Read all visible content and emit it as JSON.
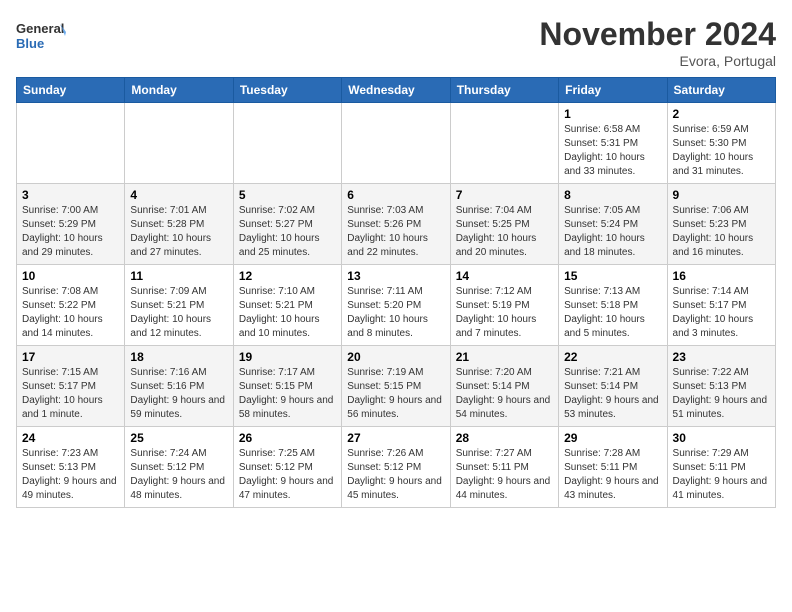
{
  "header": {
    "logo_line1": "General",
    "logo_line2": "Blue",
    "month": "November 2024",
    "location": "Evora, Portugal"
  },
  "weekdays": [
    "Sunday",
    "Monday",
    "Tuesday",
    "Wednesday",
    "Thursday",
    "Friday",
    "Saturday"
  ],
  "weeks": [
    [
      {
        "day": "",
        "info": ""
      },
      {
        "day": "",
        "info": ""
      },
      {
        "day": "",
        "info": ""
      },
      {
        "day": "",
        "info": ""
      },
      {
        "day": "",
        "info": ""
      },
      {
        "day": "1",
        "info": "Sunrise: 6:58 AM\nSunset: 5:31 PM\nDaylight: 10 hours and 33 minutes."
      },
      {
        "day": "2",
        "info": "Sunrise: 6:59 AM\nSunset: 5:30 PM\nDaylight: 10 hours and 31 minutes."
      }
    ],
    [
      {
        "day": "3",
        "info": "Sunrise: 7:00 AM\nSunset: 5:29 PM\nDaylight: 10 hours and 29 minutes."
      },
      {
        "day": "4",
        "info": "Sunrise: 7:01 AM\nSunset: 5:28 PM\nDaylight: 10 hours and 27 minutes."
      },
      {
        "day": "5",
        "info": "Sunrise: 7:02 AM\nSunset: 5:27 PM\nDaylight: 10 hours and 25 minutes."
      },
      {
        "day": "6",
        "info": "Sunrise: 7:03 AM\nSunset: 5:26 PM\nDaylight: 10 hours and 22 minutes."
      },
      {
        "day": "7",
        "info": "Sunrise: 7:04 AM\nSunset: 5:25 PM\nDaylight: 10 hours and 20 minutes."
      },
      {
        "day": "8",
        "info": "Sunrise: 7:05 AM\nSunset: 5:24 PM\nDaylight: 10 hours and 18 minutes."
      },
      {
        "day": "9",
        "info": "Sunrise: 7:06 AM\nSunset: 5:23 PM\nDaylight: 10 hours and 16 minutes."
      }
    ],
    [
      {
        "day": "10",
        "info": "Sunrise: 7:08 AM\nSunset: 5:22 PM\nDaylight: 10 hours and 14 minutes."
      },
      {
        "day": "11",
        "info": "Sunrise: 7:09 AM\nSunset: 5:21 PM\nDaylight: 10 hours and 12 minutes."
      },
      {
        "day": "12",
        "info": "Sunrise: 7:10 AM\nSunset: 5:21 PM\nDaylight: 10 hours and 10 minutes."
      },
      {
        "day": "13",
        "info": "Sunrise: 7:11 AM\nSunset: 5:20 PM\nDaylight: 10 hours and 8 minutes."
      },
      {
        "day": "14",
        "info": "Sunrise: 7:12 AM\nSunset: 5:19 PM\nDaylight: 10 hours and 7 minutes."
      },
      {
        "day": "15",
        "info": "Sunrise: 7:13 AM\nSunset: 5:18 PM\nDaylight: 10 hours and 5 minutes."
      },
      {
        "day": "16",
        "info": "Sunrise: 7:14 AM\nSunset: 5:17 PM\nDaylight: 10 hours and 3 minutes."
      }
    ],
    [
      {
        "day": "17",
        "info": "Sunrise: 7:15 AM\nSunset: 5:17 PM\nDaylight: 10 hours and 1 minute."
      },
      {
        "day": "18",
        "info": "Sunrise: 7:16 AM\nSunset: 5:16 PM\nDaylight: 9 hours and 59 minutes."
      },
      {
        "day": "19",
        "info": "Sunrise: 7:17 AM\nSunset: 5:15 PM\nDaylight: 9 hours and 58 minutes."
      },
      {
        "day": "20",
        "info": "Sunrise: 7:19 AM\nSunset: 5:15 PM\nDaylight: 9 hours and 56 minutes."
      },
      {
        "day": "21",
        "info": "Sunrise: 7:20 AM\nSunset: 5:14 PM\nDaylight: 9 hours and 54 minutes."
      },
      {
        "day": "22",
        "info": "Sunrise: 7:21 AM\nSunset: 5:14 PM\nDaylight: 9 hours and 53 minutes."
      },
      {
        "day": "23",
        "info": "Sunrise: 7:22 AM\nSunset: 5:13 PM\nDaylight: 9 hours and 51 minutes."
      }
    ],
    [
      {
        "day": "24",
        "info": "Sunrise: 7:23 AM\nSunset: 5:13 PM\nDaylight: 9 hours and 49 minutes."
      },
      {
        "day": "25",
        "info": "Sunrise: 7:24 AM\nSunset: 5:12 PM\nDaylight: 9 hours and 48 minutes."
      },
      {
        "day": "26",
        "info": "Sunrise: 7:25 AM\nSunset: 5:12 PM\nDaylight: 9 hours and 47 minutes."
      },
      {
        "day": "27",
        "info": "Sunrise: 7:26 AM\nSunset: 5:12 PM\nDaylight: 9 hours and 45 minutes."
      },
      {
        "day": "28",
        "info": "Sunrise: 7:27 AM\nSunset: 5:11 PM\nDaylight: 9 hours and 44 minutes."
      },
      {
        "day": "29",
        "info": "Sunrise: 7:28 AM\nSunset: 5:11 PM\nDaylight: 9 hours and 43 minutes."
      },
      {
        "day": "30",
        "info": "Sunrise: 7:29 AM\nSunset: 5:11 PM\nDaylight: 9 hours and 41 minutes."
      }
    ]
  ]
}
